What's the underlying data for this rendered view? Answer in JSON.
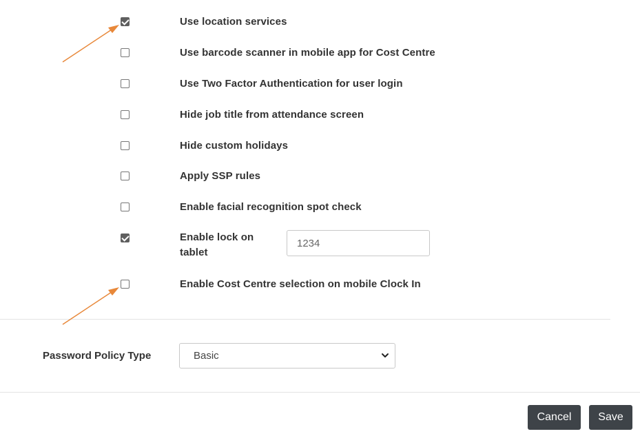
{
  "settings": {
    "items": [
      {
        "label": "Use location services",
        "checked": true
      },
      {
        "label": "Use barcode scanner in mobile app for Cost Centre",
        "checked": false
      },
      {
        "label": "Use Two Factor Authentication for user login",
        "checked": false
      },
      {
        "label": "Hide job title from attendance screen",
        "checked": false
      },
      {
        "label": "Hide custom holidays",
        "checked": false
      },
      {
        "label": "Apply SSP rules",
        "checked": false
      },
      {
        "label": "Enable facial recognition spot check",
        "checked": false
      },
      {
        "label": "Enable lock on tablet",
        "checked": true
      },
      {
        "label": "Enable Cost Centre selection on mobile Clock In",
        "checked": false
      }
    ],
    "lock_pin_value": "1234"
  },
  "password_policy": {
    "label": "Password Policy Type",
    "selected": "Basic"
  },
  "footer": {
    "cancel_label": "Cancel",
    "save_label": "Save"
  },
  "colors": {
    "annotation_arrow": "#e8883a",
    "button_bg": "#3e4348",
    "checkbox_checked": "#5f5f5f"
  }
}
